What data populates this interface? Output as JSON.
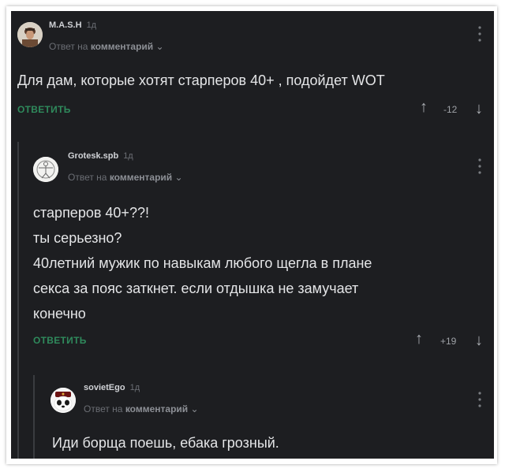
{
  "comments": [
    {
      "username": "M.A.S.H",
      "time": "1д",
      "reply_prefix": "Ответ на",
      "reply_target": "комментарий",
      "text_lines": [
        "Для дам, которые хотят старперов 40+ , подойдет WOT"
      ],
      "reply_label": "ОТВЕТИТЬ",
      "rating": "-12"
    },
    {
      "username": "Grotesk.spb",
      "time": "1д",
      "reply_prefix": "Ответ на",
      "reply_target": "комментарий",
      "text_lines": [
        "старперов 40+??!",
        "ты серьезно?",
        "40летний мужик по навыкам любого щегла в плане",
        "секса за пояс заткнет. если отдышка не замучает",
        "конечно"
      ],
      "reply_label": "ОТВЕТИТЬ",
      "rating": "+19"
    },
    {
      "username": "sovietEgo",
      "time": "1д",
      "reply_prefix": "Ответ на",
      "reply_target": "комментарий",
      "text_lines": [
        "Иди борща поешь, ебака грозный."
      ]
    }
  ],
  "icons": {
    "upvote": "↑",
    "downvote": "↓",
    "chevron": "⌄",
    "more": "⋮"
  },
  "colors": {
    "background": "#1d1e21",
    "reply_green": "#2f8a5c",
    "text": "#e4e5e7"
  }
}
